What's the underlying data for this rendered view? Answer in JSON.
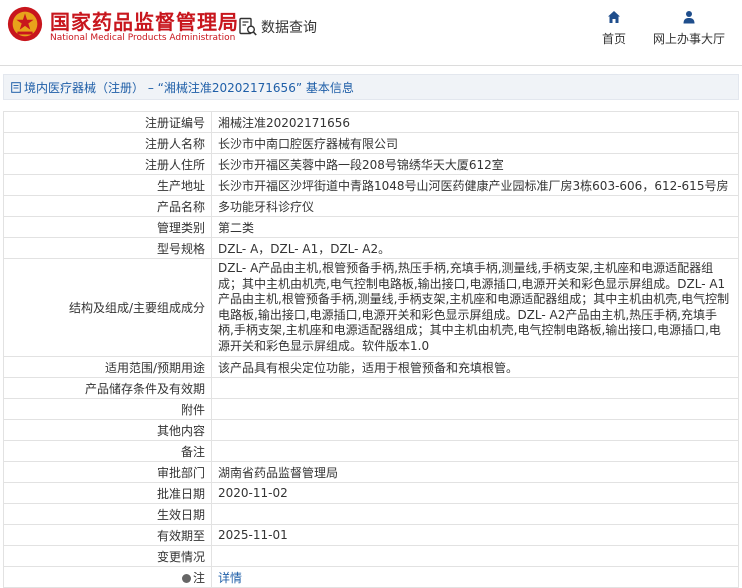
{
  "header": {
    "logo_cn": "国家药品监督管理局",
    "logo_en": "National Medical Products Administration",
    "query_label": "数据查询",
    "nav": [
      {
        "label": "首页",
        "icon": "home-icon"
      },
      {
        "label": "网上办事大厅",
        "icon": "user-icon"
      }
    ]
  },
  "breadcrumb": {
    "text": "境内医疗器械（注册） – “湘械注准20202171656” 基本信息"
  },
  "rows": [
    {
      "label": "注册证编号",
      "value": "湘械注准20202171656"
    },
    {
      "label": "注册人名称",
      "value": "长沙市中南口腔医疗器械有限公司"
    },
    {
      "label": "注册人住所",
      "value": "长沙市开福区芙蓉中路一段208号锦绣华天大厦612室"
    },
    {
      "label": "生产地址",
      "value": "长沙市开福区沙坪街道中青路1048号山河医药健康产业园标准厂房3栋603-606，612-615号房"
    },
    {
      "label": "产品名称",
      "value": "多功能牙科诊疗仪"
    },
    {
      "label": "管理类别",
      "value": "第二类"
    },
    {
      "label": "型号规格",
      "value": "DZL- A，DZL- A1，DZL- A2。"
    },
    {
      "label": "结构及组成/主要组成成分",
      "value": "DZL- A产品由主机,根管预备手柄,热压手柄,充填手柄,测量线,手柄支架,主机座和电源适配器组成；其中主机由机壳,电气控制电路板,输出接口,电源插口,电源开关和彩色显示屏组成。DZL- A1产品由主机,根管预备手柄,测量线,手柄支架,主机座和电源适配器组成；其中主机由机壳,电气控制电路板,输出接口,电源插口,电源开关和彩色显示屏组成。DZL- A2产品由主机,热压手柄,充填手柄,手柄支架,主机座和电源适配器组成；其中主机由机壳,电气控制电路板,输出接口,电源插口,电源开关和彩色显示屏组成。软件版本1.0"
    },
    {
      "label": "适用范围/预期用途",
      "value": "该产品具有根尖定位功能，适用于根管预备和充填根管。"
    },
    {
      "label": "产品储存条件及有效期",
      "value": ""
    },
    {
      "label": "附件",
      "value": ""
    },
    {
      "label": "其他内容",
      "value": ""
    },
    {
      "label": "备注",
      "value": ""
    },
    {
      "label": "审批部门",
      "value": "湖南省药品监督管理局"
    },
    {
      "label": "批准日期",
      "value": "2020-11-02"
    },
    {
      "label": "生效日期",
      "value": ""
    },
    {
      "label": "有效期至",
      "value": "2025-11-01"
    },
    {
      "label": "变更情况",
      "value": ""
    }
  ],
  "note_row": {
    "label": "注",
    "link": "详情"
  },
  "colors": {
    "brand_red": "#c8161d",
    "link_blue": "#1f5fa8"
  }
}
